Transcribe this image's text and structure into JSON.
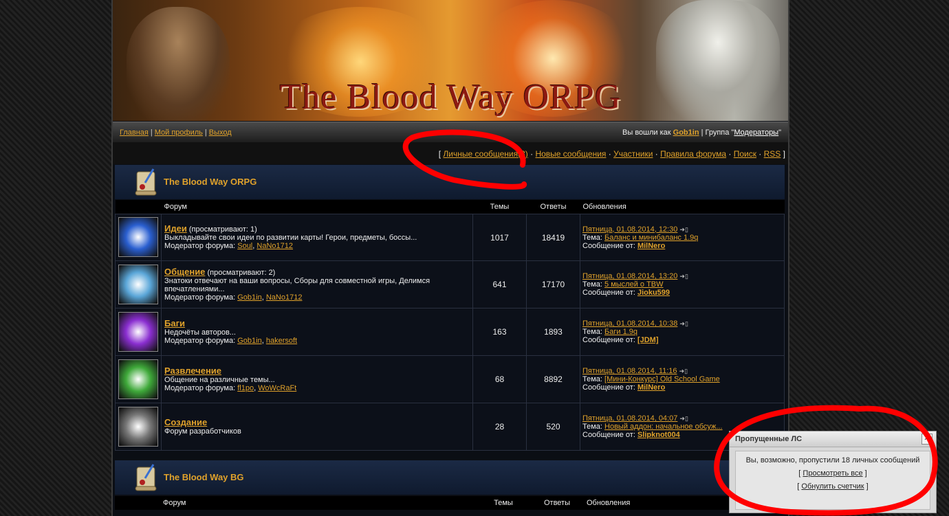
{
  "banner": {
    "title": "The Blood Way ORPG"
  },
  "topnav": {
    "links": [
      "Главная",
      "Мой профиль",
      "Выход"
    ],
    "logged_prefix": "Вы вошли как ",
    "user": "Gob1in",
    "group_prefix": " | Группа \"",
    "group": "Модераторы",
    "group_suffix": "\""
  },
  "navbar": {
    "open": "[",
    "close": "]",
    "links": [
      "Личные сообщения(3)",
      "Новые сообщения",
      "Участники",
      "Правила форума",
      "Поиск",
      "RSS"
    ]
  },
  "categories": [
    {
      "title": "The Blood Way ORPG"
    },
    {
      "title": "The Blood Way BG"
    }
  ],
  "headers": {
    "forum": "Форум",
    "topics": "Темы",
    "replies": "Ответы",
    "updates": "Обновления"
  },
  "labels": {
    "moderator": "Модератор форума: ",
    "topic": "Тема: ",
    "message": "Сообщение от: "
  },
  "forums": [
    {
      "name": "Идеи",
      "views": " (просматривают: 1)",
      "desc": "Выкладывайте свои идеи по развитии карты! Герои, предметы, боссы...",
      "mods": [
        "Soul",
        "NaNo1712"
      ],
      "topics": "1017",
      "replies": "18419",
      "date": "Пятница, 01.08.2014, 12:30",
      "topic": "Баланс и минибаланс 1.9q",
      "author": "MilNero",
      "icon_color": "#2a5fd0"
    },
    {
      "name": "Общение",
      "views": " (просматривают: 2)",
      "desc": "Знатоки отвечают на ваши вопросы, Сборы для совместной игры, Делимся впечатлениями...",
      "mods": [
        "Gob1in",
        "NaNo1712"
      ],
      "topics": "641",
      "replies": "17170",
      "date": "Пятница, 01.08.2014, 13:20",
      "topic": "5 мыслей о TBW",
      "author": "Jioku599",
      "icon_color": "#5aa6d8"
    },
    {
      "name": "Баги",
      "views": "",
      "desc": "Недочёты авторов...",
      "mods": [
        "Gob1in",
        "hakersoft"
      ],
      "topics": "163",
      "replies": "1893",
      "date": "Пятница, 01.08.2014, 10:38",
      "topic": "Баги 1.9q",
      "author": "[JDM]",
      "icon_color": "#8a2ed0"
    },
    {
      "name": "Развлечение",
      "views": "",
      "desc": "Общение на различные темы...",
      "mods": [
        "fl1po",
        "WoWcRaFt"
      ],
      "topics": "68",
      "replies": "8892",
      "date": "Пятница, 01.08.2014, 11:16",
      "topic": "[Мини-Конкурс] Old School Game",
      "author": "MilNero",
      "icon_color": "#3fa93a"
    },
    {
      "name": "Создание",
      "views": "",
      "desc": "Форум разработчиков",
      "mods": [],
      "topics": "28",
      "replies": "520",
      "date": "Пятница, 01.08.2014, 04:07",
      "topic": "Новый аддон: начальное обсуж...",
      "author": "Slipknot004",
      "icon_color": "#777777"
    }
  ],
  "popup": {
    "title": "Пропущенные ЛС",
    "message": "Вы, возможно, пропустили 18 личных сообщений",
    "view_all": "Просмотреть все",
    "reset": "Обнулить счетчик",
    "close_glyph": "✕"
  }
}
